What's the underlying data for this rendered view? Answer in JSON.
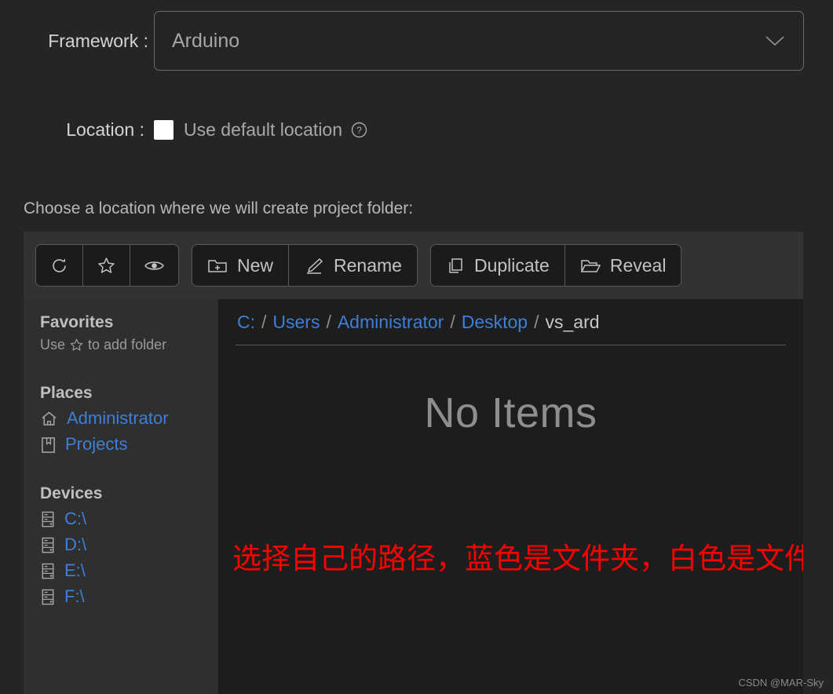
{
  "form": {
    "framework_label": "Framework :",
    "framework_value": "Arduino",
    "framework_chevron_icon": "chevron-down-icon",
    "location_label": "Location :",
    "use_default_location_label": "Use default location",
    "help_icon": "question-circle-icon",
    "checkbox_checked": false,
    "choose_location_text": "Choose a location where we will create project folder:"
  },
  "toolbar": {
    "icon_buttons": [
      {
        "name": "refresh-button",
        "icon": "refresh-icon"
      },
      {
        "name": "favorite-button",
        "icon": "star-icon"
      },
      {
        "name": "visibility-button",
        "icon": "eye-icon"
      }
    ],
    "new_label": "New",
    "new_icon": "folder-plus-icon",
    "rename_label": "Rename",
    "rename_icon": "pencil-icon",
    "duplicate_label": "Duplicate",
    "duplicate_icon": "copy-icon",
    "reveal_label": "Reveal",
    "reveal_icon": "folder-open-icon"
  },
  "sidebar": {
    "favorites_header": "Favorites",
    "favorites_hint_before": "Use",
    "favorites_hint_icon": "star-icon",
    "favorites_hint_after": "to add folder",
    "places_header": "Places",
    "places": [
      {
        "label": "Administrator",
        "icon": "home-icon"
      },
      {
        "label": "Projects",
        "icon": "book-icon"
      }
    ],
    "devices_header": "Devices",
    "devices": [
      {
        "label": "C:\\",
        "icon": "drive-icon"
      },
      {
        "label": "D:\\",
        "icon": "drive-icon"
      },
      {
        "label": "E:\\",
        "icon": "drive-icon"
      },
      {
        "label": "F:\\",
        "icon": "drive-icon"
      }
    ]
  },
  "content": {
    "breadcrumb": [
      {
        "label": "C:",
        "is_last": false
      },
      {
        "label": "Users",
        "is_last": false
      },
      {
        "label": "Administrator",
        "is_last": false
      },
      {
        "label": "Desktop",
        "is_last": false
      },
      {
        "label": "vs_ard",
        "is_last": true
      }
    ],
    "breadcrumb_separator": "/",
    "empty_message": "No Items",
    "annotation": "选择自己的路径，蓝色是文件夹，白色是文件"
  },
  "watermark": "CSDN @MAR-Sky",
  "colors": {
    "link_blue": "#3d7fd9",
    "annotation_red": "#fe0000",
    "page_bg": "#252526",
    "panel_bg": "#1d1d1d",
    "toolbar_bg": "#323232",
    "sidebar_bg": "#2f2f2f"
  }
}
